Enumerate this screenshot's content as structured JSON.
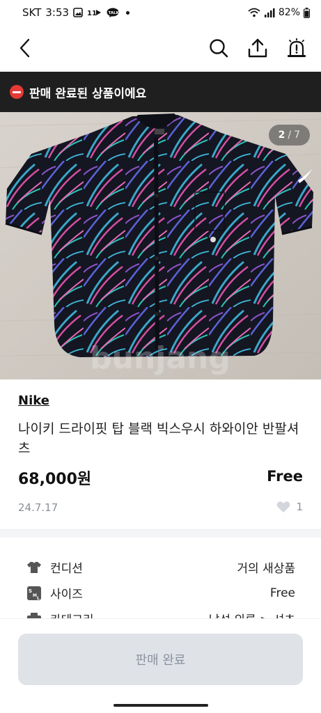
{
  "status_bar": {
    "carrier": "SKT",
    "time": "3:53",
    "battery": "82%",
    "icons": [
      "gallery-icon",
      "11st-icon",
      "talk-icon",
      "wifi-icon",
      "signal-icon",
      "battery-icon"
    ]
  },
  "header": {
    "icons": [
      "back-icon",
      "search-icon",
      "share-icon",
      "report-siren-icon"
    ]
  },
  "banner": {
    "text": "판매 완료된 상품이에요",
    "accent_color": "#e53935"
  },
  "gallery": {
    "current": "2",
    "separator": "/",
    "total": "7"
  },
  "product": {
    "brand": "Nike",
    "title": "나이키 드라이핏 탑 블랙 빅스우시 하와이안 반팔셔츠",
    "price": "68,000원",
    "shipping": "Free",
    "date": "24.7.17",
    "likes": "1"
  },
  "details": [
    {
      "icon": "shirt-condition-icon",
      "label": "컨디션",
      "value": "거의 새상품"
    },
    {
      "icon": "size-sml-icon",
      "label": "사이즈",
      "value": "Free"
    },
    {
      "icon": "category-icon",
      "label": "카테고리",
      "value": "남성 의류 > 셔츠"
    }
  ],
  "cta": {
    "label": "판매 완료"
  },
  "colors": {
    "banner_bg": "#1f1f1f",
    "cta_bg": "#dfe2e7",
    "cta_text": "#8b93a0",
    "muted": "#8a8f99"
  }
}
